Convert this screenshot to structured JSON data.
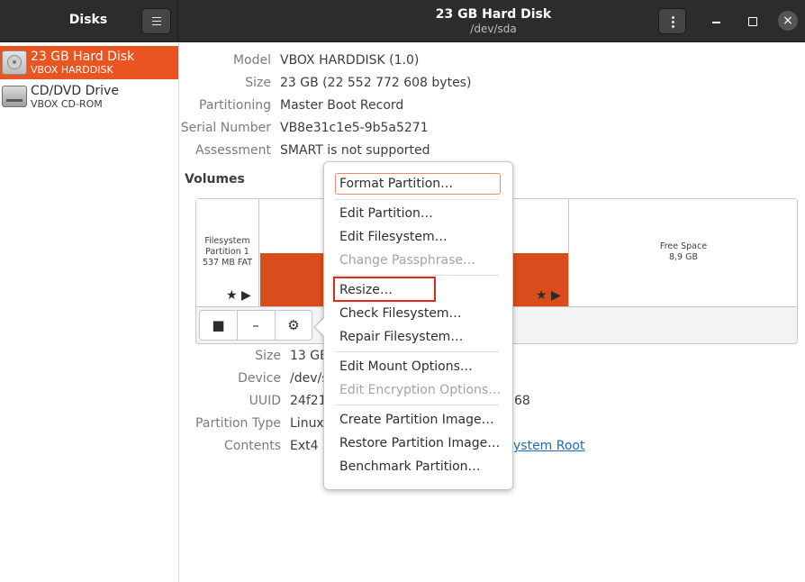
{
  "header": {
    "left_title": "Disks",
    "title": "23 GB Hard Disk",
    "subtitle": "/dev/sda",
    "close_glyph": "×"
  },
  "sidebar": {
    "drives": [
      {
        "name": "23 GB Hard Disk",
        "sub": "VBOX HARDDISK",
        "icon": "hard-disk-icon",
        "selected": true
      },
      {
        "name": "CD/DVD Drive",
        "sub": "VBOX CD-ROM",
        "icon": "optical-drive-icon",
        "selected": false
      }
    ]
  },
  "disk_details": {
    "model_label": "Model",
    "model": "VBOX HARDDISK (1.0)",
    "size_label": "Size",
    "size": "23 GB (22 552 772 608 bytes)",
    "partitioning_label": "Partitioning",
    "partitioning": "Master Boot Record",
    "serial_label": "Serial Number",
    "serial": "VB8e31c1e5-9b5a5271",
    "assessment_label": "Assessment",
    "assessment": "SMART is not supported"
  },
  "volumes": {
    "title": "Volumes",
    "partitions": [
      {
        "line1": "Filesystem",
        "line2": "Partition 1",
        "line3": "537 MB FAT"
      },
      {
        "line1": "",
        "line2": "",
        "line3": ""
      },
      {
        "line1": "Free Space",
        "line2": "8,9 GB",
        "line3": ""
      }
    ],
    "marks": "★ ▶",
    "toolbar": {
      "stop": "■",
      "minus": "–",
      "gear": "⚙"
    }
  },
  "volume_details": {
    "size_label": "Size",
    "size": "13 GB",
    "device_label": "Device",
    "device": "/dev/s",
    "uuid_label": "UUID",
    "uuid_start": "24f21",
    "uuid_end": "68",
    "ptype_label": "Partition Type",
    "ptype": "Linux",
    "contents_label": "Contents",
    "contents": "Ext4 (",
    "contents_link": "ystem Root"
  },
  "context_menu": {
    "items": [
      {
        "label": "Format Partition…",
        "disabled": false
      },
      {
        "label": "Edit Partition…",
        "disabled": false
      },
      {
        "label": "Edit Filesystem…",
        "disabled": false
      },
      {
        "label": "Change Passphrase…",
        "disabled": true
      },
      {
        "label": "Resize…",
        "disabled": false
      },
      {
        "label": "Check Filesystem…",
        "disabled": false
      },
      {
        "label": "Repair Filesystem…",
        "disabled": false
      },
      {
        "label": "Edit Mount Options…",
        "disabled": false
      },
      {
        "label": "Edit Encryption Options…",
        "disabled": true
      },
      {
        "label": "Create Partition Image…",
        "disabled": false
      },
      {
        "label": "Restore Partition Image…",
        "disabled": false
      },
      {
        "label": "Benchmark Partition…",
        "disabled": false
      }
    ]
  },
  "colors": {
    "accent": "#e95420",
    "selected_partition": "#d84d1b",
    "highlight": "#e0281f",
    "headerbar": "#2c2c2c"
  }
}
